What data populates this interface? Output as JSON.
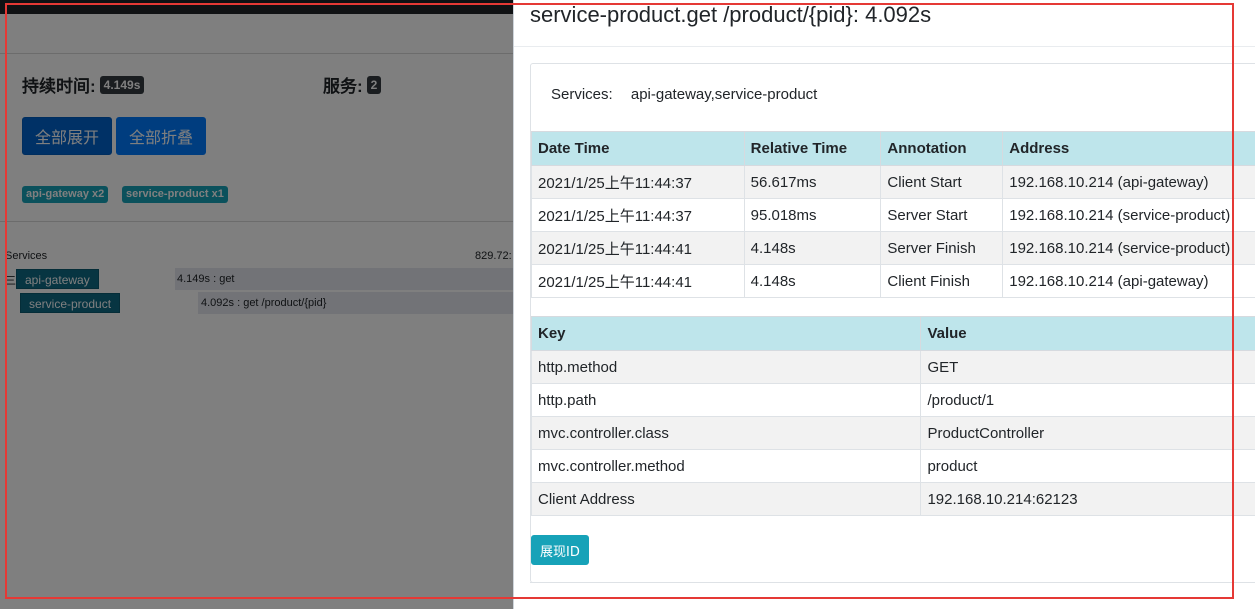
{
  "background": {
    "duration_label": "持续时间:",
    "duration_value": "4.149s",
    "services_label": "服务:",
    "services_count": "2",
    "expand_all": "全部展开",
    "collapse_all": "全部折叠",
    "tags": [
      "api-gateway x2",
      "service-product x1"
    ],
    "timeline_header": "Services",
    "timeline_right": "829.72:",
    "expander": "三",
    "rows": [
      {
        "service": "api-gateway",
        "span": "4.149s : get"
      },
      {
        "service": "service-product",
        "span": "4.092s : get /product/{pid}"
      }
    ]
  },
  "drawer": {
    "title": "service-product.get /product/{pid}: 4.092s",
    "services_label": "Services:",
    "services_value": "api-gateway,service-product",
    "annotations": {
      "headers": [
        "Date Time",
        "Relative Time",
        "Annotation",
        "Address"
      ],
      "rows": [
        [
          "2021/1/25上午11:44:37",
          "56.617ms",
          "Client Start",
          "192.168.10.214 (api-gateway)"
        ],
        [
          "2021/1/25上午11:44:37",
          "95.018ms",
          "Server Start",
          "192.168.10.214 (service-product)"
        ],
        [
          "2021/1/25上午11:44:41",
          "4.148s",
          "Server Finish",
          "192.168.10.214 (service-product)"
        ],
        [
          "2021/1/25上午11:44:41",
          "4.148s",
          "Client Finish",
          "192.168.10.214 (api-gateway)"
        ]
      ]
    },
    "tags": {
      "headers": [
        "Key",
        "Value"
      ],
      "rows": [
        [
          "http.method",
          "GET"
        ],
        [
          "http.path",
          "/product/1"
        ],
        [
          "mvc.controller.class",
          "ProductController"
        ],
        [
          "mvc.controller.method",
          "product"
        ],
        [
          "Client Address",
          "192.168.10.214:62123"
        ]
      ]
    },
    "show_id_button": "展现ID"
  },
  "colors": {
    "primary": "#007bff",
    "info": "#17a2b8",
    "table_header": "#bee5eb",
    "highlight": "#e53935"
  }
}
